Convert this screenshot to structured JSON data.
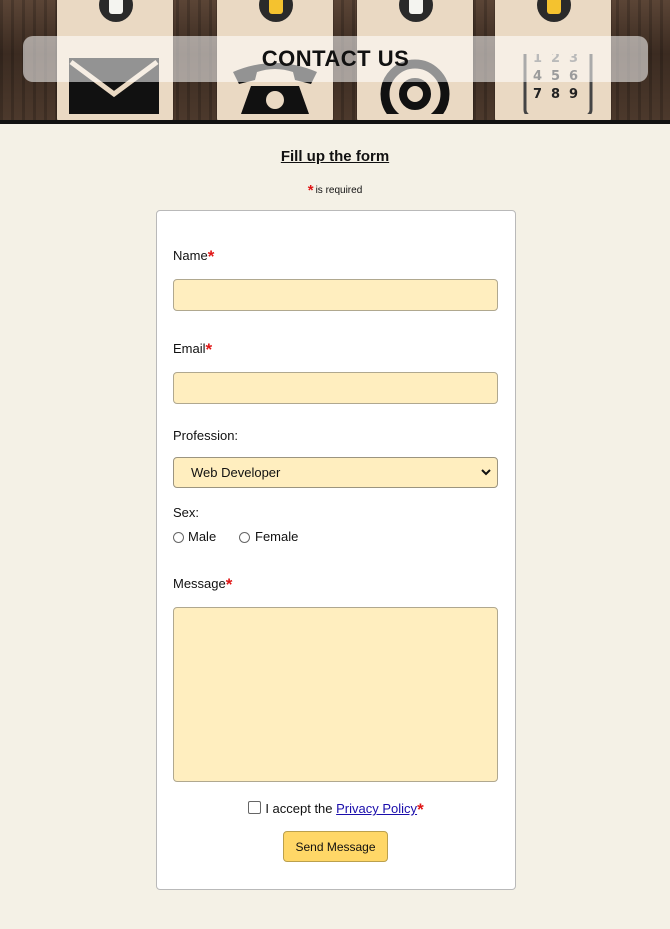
{
  "header": {
    "title": "CONTACT US"
  },
  "intro": {
    "heading": "Fill up the form",
    "required_star": "*",
    "required_note": "is required"
  },
  "form": {
    "name_label": "Name",
    "email_label": "Email",
    "profession_label": "Profession:",
    "profession_selected": "Web Developer",
    "sex_label": "Sex:",
    "sex_options": [
      "Male",
      "Female"
    ],
    "message_label": "Message",
    "accept_prefix": "I accept the ",
    "privacy_link": "Privacy Policy",
    "required_star": "*",
    "send_label": "Send Message"
  },
  "colors": {
    "field_bg": "#ffeebf",
    "button_bg": "#ffd767",
    "required": "#e01616"
  },
  "icons": {
    "banner": [
      "envelope-icon",
      "telephone-icon",
      "at-sign-icon",
      "keypad-icon"
    ],
    "select": "chevron-down-icon"
  }
}
